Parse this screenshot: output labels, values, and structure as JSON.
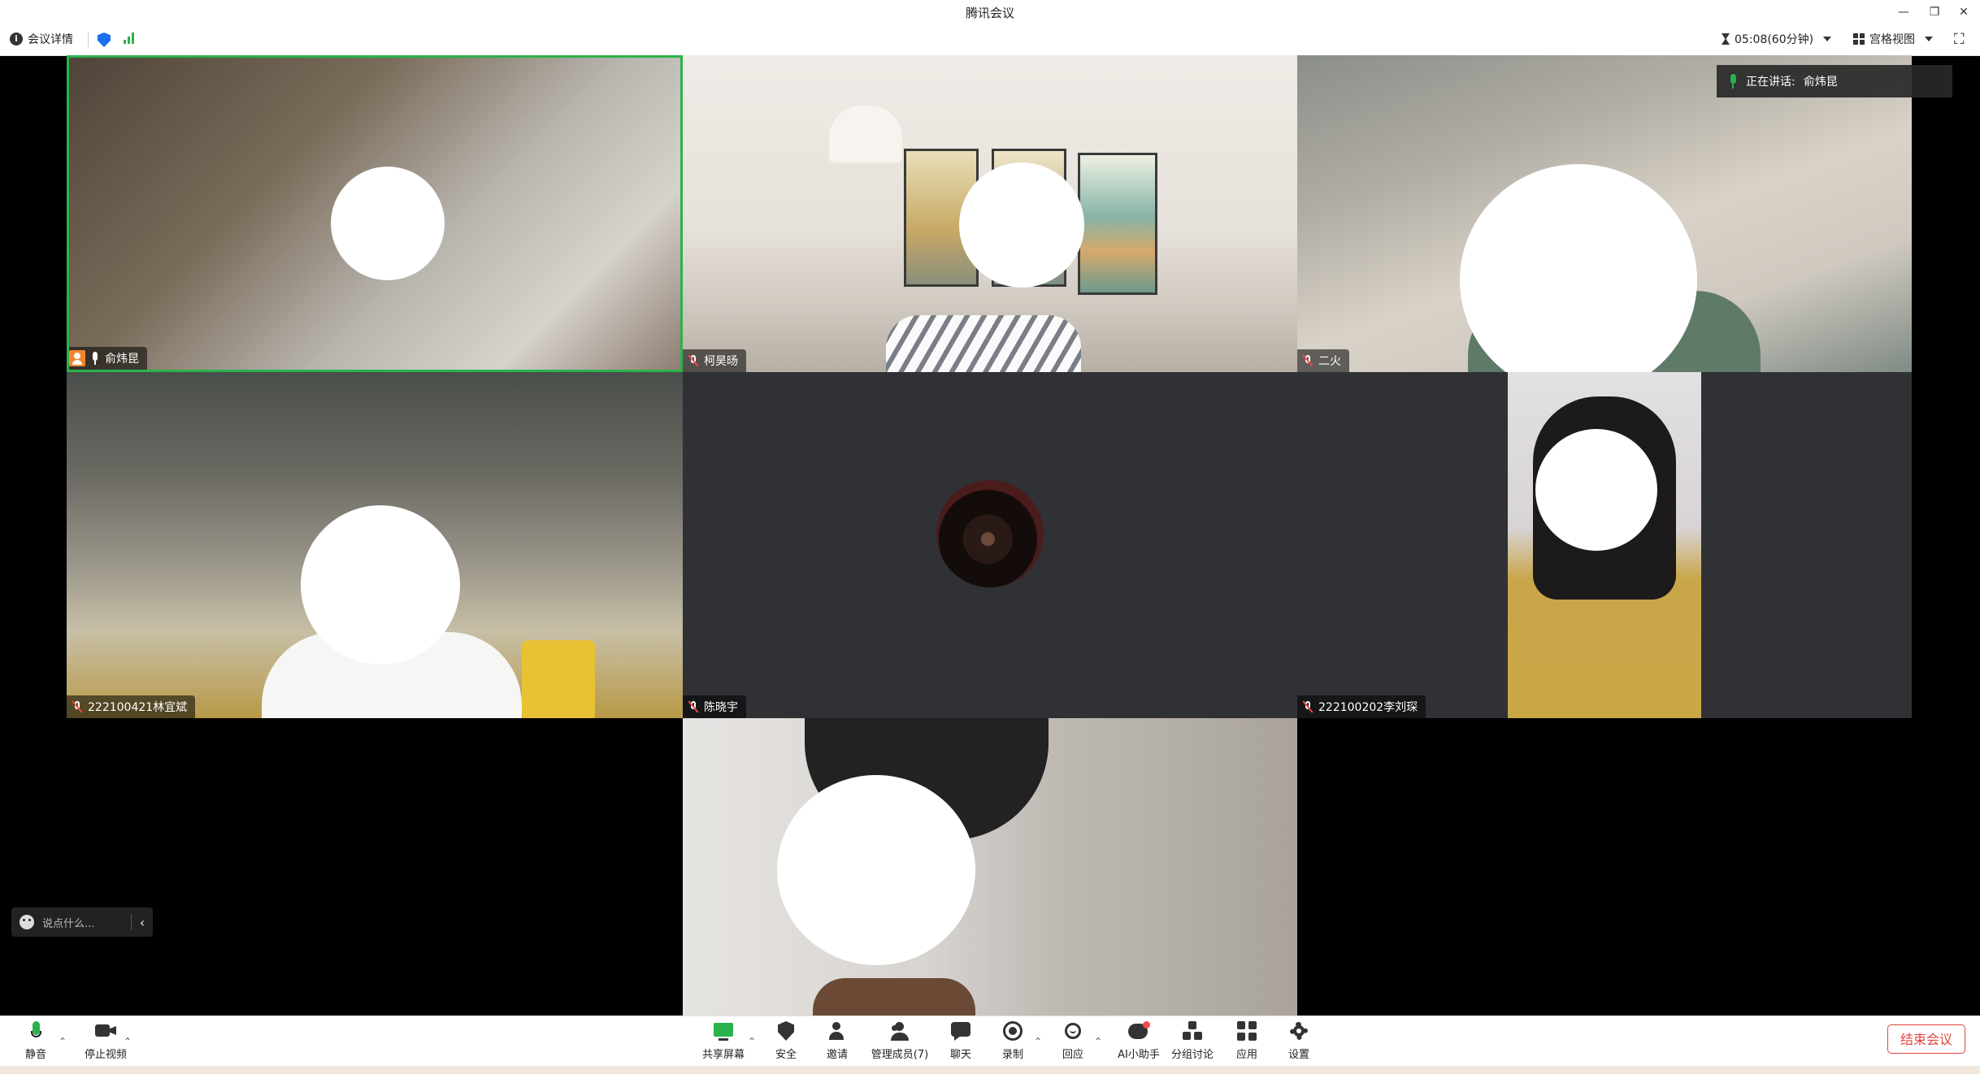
{
  "window": {
    "title": "腾讯会议",
    "controls": [
      "minimize-icon",
      "restore-icon",
      "close-icon"
    ]
  },
  "infobar": {
    "meeting_details": "会议详情",
    "timer": "05:08(60分钟)",
    "view_mode": "宫格视图"
  },
  "speaking": {
    "label": "正在讲话:",
    "name": "俞炜昆"
  },
  "tiles": [
    {
      "name": "俞炜昆",
      "mic": "on",
      "host": true,
      "active_speaker": true
    },
    {
      "name": "柯昊旸",
      "mic": "muted"
    },
    {
      "name": "二火",
      "mic": "muted"
    },
    {
      "name": "222100421林宜斌",
      "mic": "muted"
    },
    {
      "name": "陈晓宇",
      "mic": "muted",
      "video": "off"
    },
    {
      "name": "222100202李刘琛",
      "mic": "muted"
    },
    {
      "name": "",
      "mic": "muted"
    }
  ],
  "chat": {
    "placeholder": "说点什么..."
  },
  "toolbar": {
    "mute": "静音",
    "stop_video": "停止视频",
    "share_screen": "共享屏幕",
    "security": "安全",
    "invite": "邀请",
    "manage_members": "管理成员(7)",
    "chat": "聊天",
    "record": "录制",
    "react": "回应",
    "ai_assistant": "AI小助手",
    "breakout": "分组讨论",
    "apps": "应用",
    "settings": "设置",
    "end_meeting": "结束会议"
  },
  "colors": {
    "accent_green": "#2bb24c",
    "security_blue": "#1d6ff2",
    "end_red": "#e0443f",
    "tile_bg": "#2f3135"
  }
}
